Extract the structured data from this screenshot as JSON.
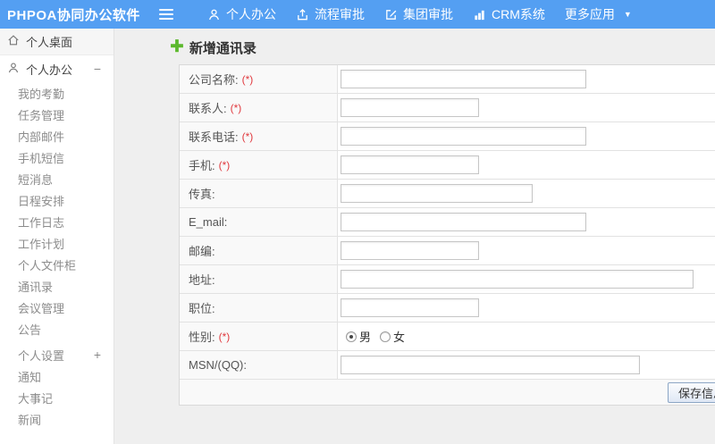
{
  "topbar": {
    "title": "PHPOA协同办公软件",
    "menu": [
      {
        "label": "个人办公"
      },
      {
        "label": "流程审批"
      },
      {
        "label": "集团审批"
      },
      {
        "label": "CRM系统"
      },
      {
        "label": "更多应用"
      }
    ]
  },
  "sidebar": {
    "desktop": {
      "label": "个人桌面"
    },
    "office_group": {
      "label": "个人办公",
      "toggle": "−"
    },
    "items": [
      "我的考勤",
      "任务管理",
      "内部邮件",
      "手机短信",
      "短消息",
      "日程安排",
      "工作日志",
      "工作计划",
      "个人文件柜",
      "通讯录",
      "会议管理",
      "公告"
    ],
    "settings_group": {
      "label": "个人设置",
      "toggle": "+"
    },
    "extra_items": [
      "通知",
      "大事记",
      "新闻"
    ]
  },
  "main": {
    "page_title": "新增通讯录",
    "form": {
      "rows": [
        {
          "label": "公司名称:",
          "req": "(*)"
        },
        {
          "label": "联系人:",
          "req": "(*)"
        },
        {
          "label": "联系电话:",
          "req": "(*)"
        },
        {
          "label": "手机:",
          "req": "(*)"
        },
        {
          "label": "传真:",
          "req": ""
        },
        {
          "label": "E_mail:",
          "req": ""
        },
        {
          "label": "邮编:",
          "req": ""
        },
        {
          "label": "地址:",
          "req": ""
        },
        {
          "label": "职位:",
          "req": ""
        },
        {
          "label": "性别:",
          "req": "(*)"
        },
        {
          "label": "MSN/(QQ):",
          "req": ""
        }
      ],
      "gender_options": [
        {
          "label": "男",
          "checked": true
        },
        {
          "label": "女",
          "checked": false
        }
      ],
      "save_label": "保存信息"
    }
  },
  "colors": {
    "topbar_blue": "#549ff2",
    "required_red": "#e0393e",
    "plus_green": "#5cb82e",
    "content_bg": "#efefef"
  }
}
